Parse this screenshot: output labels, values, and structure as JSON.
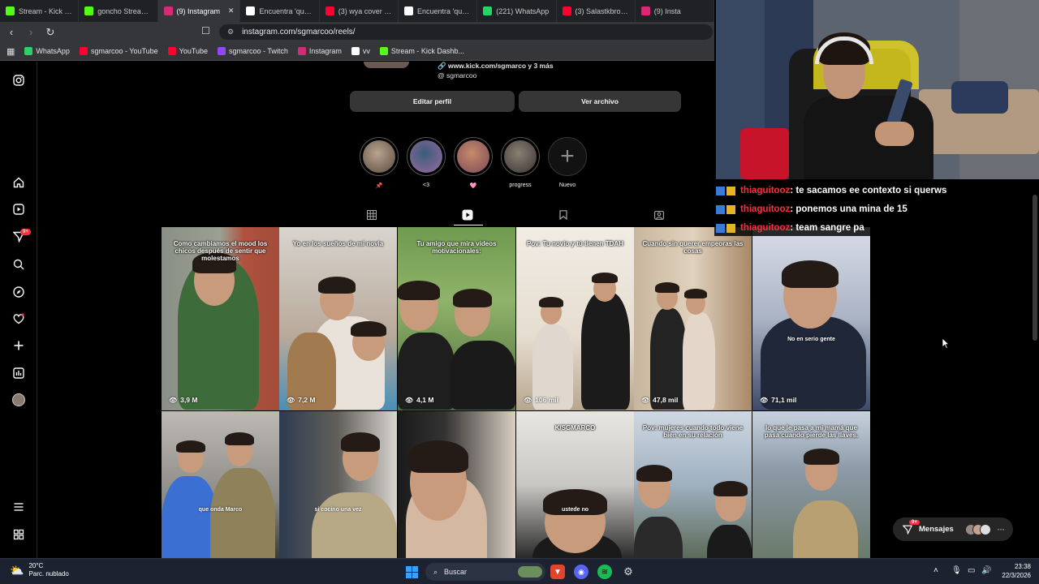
{
  "browser": {
    "tabs": [
      {
        "label": "Stream - Kick Dashb",
        "icon": "kick-icon",
        "color": "#53fc18",
        "active": false
      },
      {
        "label": "goncho Stream - W",
        "icon": "kick-icon",
        "color": "#53fc18",
        "active": false
      },
      {
        "label": "(9) Instagram",
        "icon": "instagram-icon",
        "color": "#d62976",
        "active": true
      },
      {
        "label": "Encuentra 'que hac",
        "icon": "tiktok-icon",
        "color": "#ffffff",
        "active": false
      },
      {
        "label": "(3) wya cover salas",
        "icon": "youtube-icon",
        "color": "#ff0033",
        "active": false
      },
      {
        "label": "Encuentra 'que va a",
        "icon": "tiktok-icon",
        "color": "#ffffff",
        "active": false
      },
      {
        "label": "(221) WhatsApp",
        "icon": "whatsapp-icon",
        "color": "#25d366",
        "active": false
      },
      {
        "label": "(3) Salastkbron - Yo",
        "icon": "youtube-icon",
        "color": "#ff0033",
        "active": false
      },
      {
        "label": "(9) Insta",
        "icon": "instagram-icon",
        "color": "#d62976",
        "active": false
      }
    ],
    "url": "instagram.com/sgmarcoo/reels/",
    "bookmarks": [
      {
        "label": "WhatsApp",
        "icon": "whatsapp-icon",
        "color": "#25d366"
      },
      {
        "label": "sgmarcoo - YouTube",
        "icon": "youtube-icon",
        "color": "#ff0033"
      },
      {
        "label": "YouTube",
        "icon": "youtube-icon",
        "color": "#ff0033"
      },
      {
        "label": "sgmarcoo - Twitch",
        "icon": "twitch-icon",
        "color": "#9146ff"
      },
      {
        "label": "Instagram",
        "icon": "instagram-icon",
        "color": "#d62976"
      },
      {
        "label": "vv",
        "icon": "x-icon",
        "color": "#ffffff"
      },
      {
        "label": "Stream - Kick Dashb...",
        "icon": "kick-icon",
        "color": "#53fc18"
      }
    ]
  },
  "profile": {
    "link_text": "www.kick.com/sgmarco y 3 más",
    "threads_handle": "sgmarcoo",
    "edit_button": "Editar perfil",
    "archive_button": "Ver archivo",
    "highlights": [
      {
        "label": "📌"
      },
      {
        "label": "<3"
      },
      {
        "label": "🩷"
      },
      {
        "label": "progress"
      }
    ],
    "new_highlight_label": "Nuevo"
  },
  "reels": [
    {
      "caption": "Como cambiamos el mood los chicos después de sentir que molestamos",
      "views": "3,9 M"
    },
    {
      "caption": "Yo en los sueños de mi novia",
      "views": "7,2 M"
    },
    {
      "caption": "Tu amigo que mira videos motivacionales:",
      "views": "4,1 M"
    },
    {
      "caption": "Pov: Tu novio y tú tienen TDAH",
      "views": "106 mil"
    },
    {
      "caption": "Cuando sin querer empeoras las cosas",
      "views": "47,8 mil"
    },
    {
      "caption": "",
      "subtitle": "No en serio gente",
      "views": "71,1 mil"
    },
    {
      "caption": "",
      "subtitle": "que onda Marco",
      "views": ""
    },
    {
      "caption": "",
      "subtitle": "si cocino una vez",
      "views": ""
    },
    {
      "caption": "",
      "subtitle": "",
      "views": ""
    },
    {
      "caption": "K/SGMARCO",
      "subtitle": "ustede no",
      "views": ""
    },
    {
      "caption": "Pov: mujeres cuando todo viene bien en su relación",
      "views": ""
    },
    {
      "caption": "lo que le pasa a mi mamá que pasa cuando pierde las llaves.",
      "views": ""
    }
  ],
  "chat": [
    {
      "user": "thiaguitooz",
      "message": ": te sacamos ee contexto si querws"
    },
    {
      "user": "thiaguitooz",
      "message": ": ponemos una mina de 15"
    },
    {
      "user": "thiaguitooz",
      "message": ": team sangre pa"
    }
  ],
  "messages_button": {
    "label": "Mensajes",
    "badge": "9+"
  },
  "nav_badge": "9+",
  "taskbar": {
    "weather_temp": "20°C",
    "weather_desc": "Parc. nublado",
    "search_placeholder": "Buscar",
    "time": "23:38",
    "date": "22/3/2026"
  }
}
